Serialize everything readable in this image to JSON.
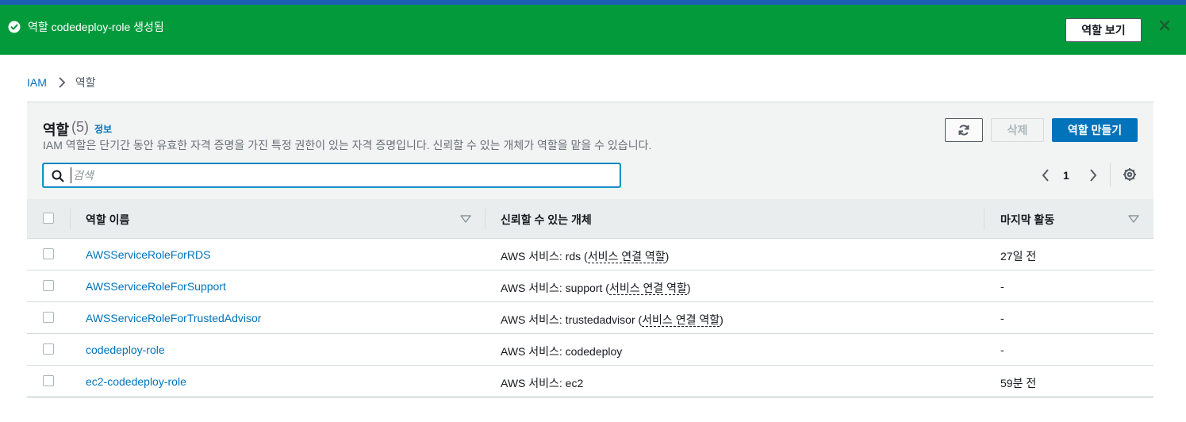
{
  "flash": {
    "message": "역할 codedeploy-role 생성됨",
    "button_label": "역할 보기",
    "color": "#039a3c"
  },
  "breadcrumb": {
    "root": "IAM",
    "current": "역할"
  },
  "roles_panel": {
    "title": "역할",
    "count": "(5)",
    "info_link": "정보",
    "description": "IAM 역할은 단기간 동안 유효한 자격 증명을 가진 특정 권한이 있는 자격 증명입니다. 신뢰할 수 있는 개체가 역할을 맡을 수 있습니다.",
    "delete_label": "삭제",
    "create_label": "역할 만들기",
    "search_placeholder": "검색",
    "page": "1"
  },
  "table": {
    "columns": [
      "역할 이름",
      "신뢰할 수 있는 개체",
      "마지막 활동"
    ],
    "rows": [
      {
        "name": "AWSServiceRoleForRDS",
        "trust_prefix": "AWS 서비스: rds (",
        "trust_link": "서비스 연결 역할",
        "trust_suffix": ")",
        "activity": "27일 전"
      },
      {
        "name": "AWSServiceRoleForSupport",
        "trust_prefix": "AWS 서비스: support (",
        "trust_link": "서비스 연결 역할",
        "trust_suffix": ")",
        "activity": "-"
      },
      {
        "name": "AWSServiceRoleForTrustedAdvisor",
        "trust_prefix": "AWS 서비스: trustedadvisor (",
        "trust_link": "서비스 연결 역할",
        "trust_suffix": ")",
        "activity": "-"
      },
      {
        "name": "codedeploy-role",
        "trust_prefix": "AWS 서비스: codedeploy",
        "trust_link": "",
        "trust_suffix": "",
        "activity": "-"
      },
      {
        "name": "ec2-codedeploy-role",
        "trust_prefix": "AWS 서비스: ec2",
        "trust_link": "",
        "trust_suffix": "",
        "activity": "59분 전"
      }
    ]
  },
  "colors": {
    "link": "#0073bb",
    "primary_button": "#0073bb",
    "success_banner": "#039a3c"
  }
}
